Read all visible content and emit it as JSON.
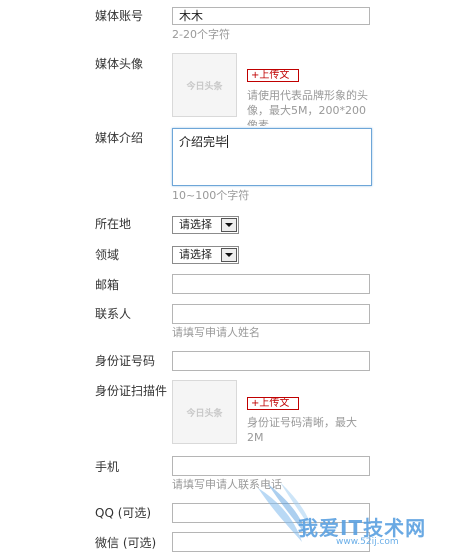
{
  "form": {
    "account": {
      "label": "媒体账号",
      "value": "木木",
      "hint": "2-20个字符"
    },
    "avatar": {
      "label": "媒体头像",
      "placeholder_text": "今日头条",
      "upload_label": "+上传文",
      "desc": "请使用代表品牌形象的头像，最大5M，200*200像素"
    },
    "intro": {
      "label": "媒体介绍",
      "value": "介绍完毕",
      "hint": "10~100个字符"
    },
    "location": {
      "label": "所在地",
      "selected": "请选择"
    },
    "domain": {
      "label": "领域",
      "selected": "请选择"
    },
    "email": {
      "label": "邮箱",
      "value": ""
    },
    "contact": {
      "label": "联系人",
      "value": "",
      "hint": "请填写申请人姓名"
    },
    "id_number": {
      "label": "身份证号码",
      "value": ""
    },
    "id_scan": {
      "label": "身份证扫描件",
      "placeholder_text": "今日头条",
      "upload_label": "+上传文",
      "desc": "身份证号码清晰，最大2M"
    },
    "phone": {
      "label": "手机",
      "value": "",
      "hint": "请填写申请人联系电话"
    },
    "qq": {
      "label": "QQ (可选)",
      "value": ""
    },
    "wechat": {
      "label": "微信 (可选)",
      "value": ""
    }
  },
  "watermark": {
    "text": "我爱IT技术网",
    "url": "www.52ij.com"
  },
  "colors": {
    "accent_red": "#c00000",
    "focus_blue": "#6ea6d8",
    "hint_gray": "#999999"
  }
}
